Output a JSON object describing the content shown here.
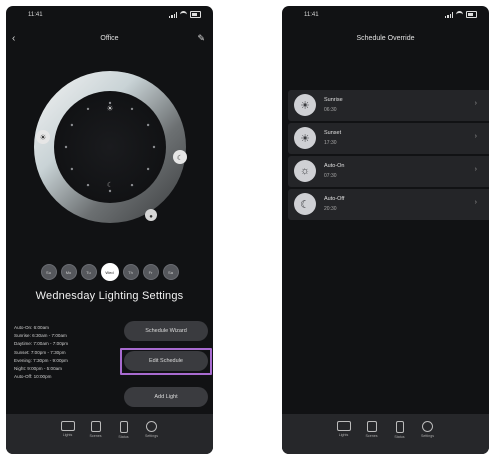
{
  "left_screen": {
    "status_time": "11:41",
    "title": "Office",
    "days": [
      "Su",
      "Mo",
      "Tu",
      "Wed",
      "Th",
      "Fr",
      "Sa"
    ],
    "active_day_index": 3,
    "settings_title": "Wednesday Lighting Settings",
    "schedule": [
      "Auto-On: 6:00am",
      "Sunrise: 6:30am - 7:00am",
      "Daytime: 7:00am - 7:00pm",
      "Sunset: 7:00pm - 7:30pm",
      "Evening: 7:30pm - 9:00pm",
      "Night: 9:00pm - 5:00am",
      "Auto-Off: 10:00pm"
    ],
    "buttons": {
      "schedule_wizard": "Schedule Wizard",
      "edit_schedule": "Edit Schedule",
      "add_light": "Add Light"
    }
  },
  "right_screen": {
    "status_time": "11:41",
    "title": "Schedule Override",
    "items": [
      {
        "name": "Sunrise",
        "time": "06:30",
        "icon": "sunrise-icon"
      },
      {
        "name": "Sunset",
        "time": "17:30",
        "icon": "sunset-icon"
      },
      {
        "name": "Auto-On",
        "time": "07:30",
        "icon": "auto-on-icon"
      },
      {
        "name": "Auto-Off",
        "time": "20:30",
        "icon": "auto-off-icon"
      }
    ]
  },
  "bottom_nav": [
    {
      "label": "Lights",
      "icon": "lights-icon"
    },
    {
      "label": "Scenes",
      "icon": "scenes-icon"
    },
    {
      "label": "Status",
      "icon": "status-icon"
    },
    {
      "label": "Settings",
      "icon": "settings-icon"
    }
  ],
  "colors": {
    "background": "#111214",
    "panel": "#242528",
    "button": "#3a3b3f",
    "highlight": "#a86bd0",
    "nav_bar": "#26272a"
  }
}
